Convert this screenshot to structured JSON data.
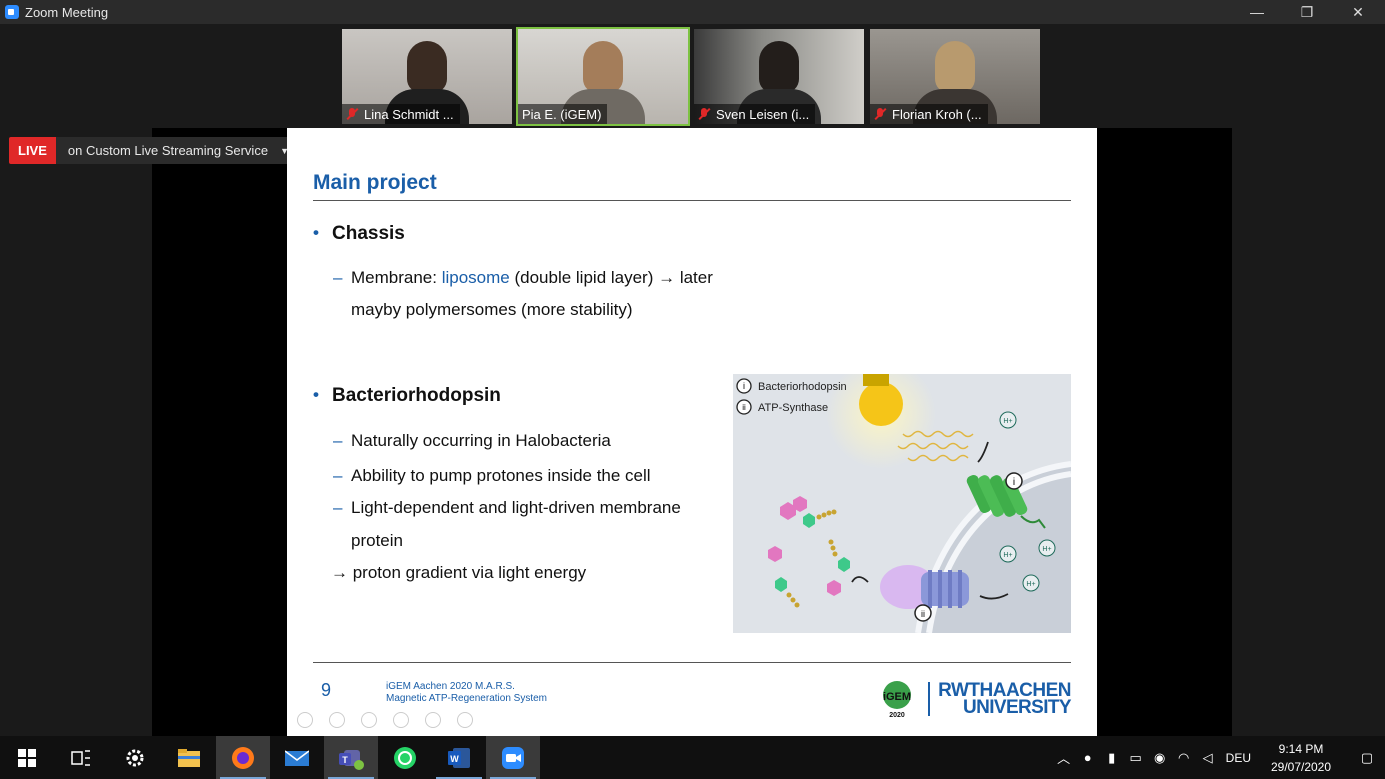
{
  "window": {
    "title": "Zoom Meeting",
    "minimize": "—",
    "restore": "❐",
    "close": "✕"
  },
  "participants": [
    {
      "name": "Lina Schmidt ...",
      "muted": true,
      "active": false
    },
    {
      "name": "Pia E. (iGEM)",
      "muted": false,
      "active": true
    },
    {
      "name": "Sven Leisen (i...",
      "muted": true,
      "active": false
    },
    {
      "name": "Florian Kroh (...",
      "muted": true,
      "active": false
    }
  ],
  "live": {
    "badge": "LIVE",
    "service": "on Custom Live Streaming Service",
    "caret": "▼"
  },
  "slide": {
    "title": "Main project",
    "section1": {
      "bullet": "•",
      "heading": "Chassis",
      "dash": "–",
      "line1_pre": "Membrane: ",
      "line1_link": "liposome",
      "line1_post": " (double lipid layer) → later",
      "line2": "mayby polymersomes (more stability)"
    },
    "section2": {
      "bullet": "•",
      "heading": "Bacteriorhodopsin",
      "dash": "–",
      "items": [
        "Naturally occurring in Halobacteria",
        "Abbility to pump protones inside the cell",
        " Light-dependent and light-driven membrane"
      ],
      "item3_cont": "protein",
      "conclusion": "→ proton gradient via light energy"
    },
    "figure": {
      "legend": [
        {
          "num": "i",
          "label": "Bacteriorhodopsin"
        },
        {
          "num": "ii",
          "label": "ATP-Synthase"
        }
      ],
      "proton": "H+"
    },
    "footer": {
      "page": "9",
      "line1": "iGEM Aachen 2020 M.A.R.S.",
      "line2": "Magnetic ATP-Regeneration System",
      "igem_year": "2020",
      "igem_text": "iGEM",
      "rwth1": "RWTHAACHEN",
      "rwth2": "UNIVERSITY"
    }
  },
  "taskbar": {
    "apps": [
      "start",
      "task-view",
      "settings",
      "file-explorer",
      "firefox",
      "mail",
      "teams",
      "whatsapp",
      "word",
      "zoom"
    ],
    "language": "DEU",
    "time": "9:14 PM",
    "date": "29/07/2020"
  },
  "colors": {
    "accent": "#1a5ea8",
    "live": "#e02828",
    "active_border": "#7dc242",
    "taskbar": "#101010"
  }
}
